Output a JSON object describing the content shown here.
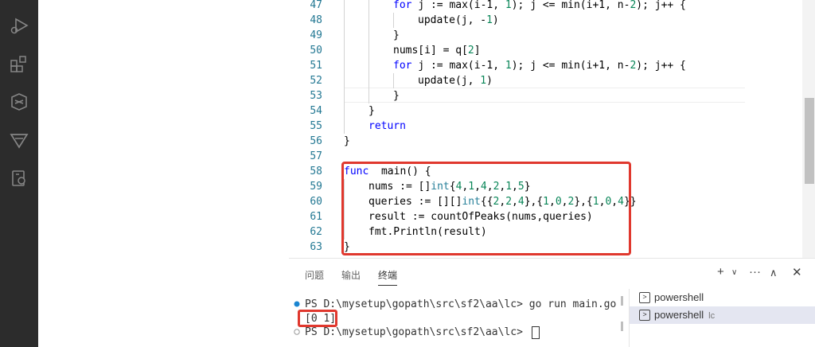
{
  "editor": {
    "lines": [
      {
        "num": "47",
        "indent": 2,
        "tokens": [
          [
            "kw",
            "for"
          ],
          [
            "",
            "j := max(i-1, "
          ],
          [
            "num",
            "1"
          ],
          [
            "",
            "); j <= min(i+1, n-"
          ],
          [
            "num",
            "2"
          ],
          [
            "",
            "); j++ {"
          ]
        ]
      },
      {
        "num": "48",
        "indent": 3,
        "tokens": [
          [
            "",
            "update(j, -"
          ],
          [
            "num",
            "1"
          ],
          [
            "",
            ")"
          ]
        ]
      },
      {
        "num": "49",
        "indent": 2,
        "tokens": [
          [
            "",
            "}"
          ]
        ]
      },
      {
        "num": "50",
        "indent": 2,
        "tokens": [
          [
            "",
            "nums[i] = q["
          ],
          [
            "num",
            "2"
          ],
          [
            "",
            "]"
          ]
        ]
      },
      {
        "num": "51",
        "indent": 2,
        "tokens": [
          [
            "kw",
            "for"
          ],
          [
            "",
            "j := max(i-1, "
          ],
          [
            "num",
            "1"
          ],
          [
            "",
            "); j <= min(i+1, n-"
          ],
          [
            "num",
            "2"
          ],
          [
            "",
            "); j++ {"
          ]
        ]
      },
      {
        "num": "52",
        "indent": 3,
        "tokens": [
          [
            "",
            "update(j, "
          ],
          [
            "num",
            "1"
          ],
          [
            "",
            ")"
          ]
        ]
      },
      {
        "num": "53",
        "indent": 2,
        "tokens": [
          [
            "",
            "}"
          ]
        ]
      },
      {
        "num": "54",
        "indent": 1,
        "tokens": [
          [
            "",
            "}"
          ]
        ]
      },
      {
        "num": "55",
        "indent": 1,
        "tokens": [
          [
            "kw",
            "return"
          ]
        ]
      },
      {
        "num": "56",
        "indent": 0,
        "tokens": [
          [
            "",
            "}"
          ]
        ]
      },
      {
        "num": "57",
        "indent": 0,
        "tokens": []
      },
      {
        "num": "58",
        "indent": 0,
        "tokens": [
          [
            "kw",
            "func"
          ],
          [
            "",
            " main() {"
          ]
        ]
      },
      {
        "num": "59",
        "indent": 1,
        "tokens": [
          [
            "",
            "nums := []"
          ],
          [
            "ty",
            "int"
          ],
          [
            "",
            "{"
          ],
          [
            "num",
            "4"
          ],
          [
            "",
            ","
          ],
          [
            "num",
            "1"
          ],
          [
            "",
            ","
          ],
          [
            "num",
            "4"
          ],
          [
            "",
            ","
          ],
          [
            "num",
            "2"
          ],
          [
            "",
            ","
          ],
          [
            "num",
            "1"
          ],
          [
            "",
            ","
          ],
          [
            "num",
            "5"
          ],
          [
            "",
            "}"
          ]
        ]
      },
      {
        "num": "60",
        "indent": 1,
        "tokens": [
          [
            "",
            "queries := [][]"
          ],
          [
            "ty",
            "int"
          ],
          [
            "",
            "{{"
          ],
          [
            "num",
            "2"
          ],
          [
            "",
            ","
          ],
          [
            "num",
            "2"
          ],
          [
            "",
            ","
          ],
          [
            "num",
            "4"
          ],
          [
            "",
            "},{"
          ],
          [
            "num",
            "1"
          ],
          [
            "",
            ","
          ],
          [
            "num",
            "0"
          ],
          [
            "",
            ","
          ],
          [
            "num",
            "2"
          ],
          [
            "",
            "},{"
          ],
          [
            "num",
            "1"
          ],
          [
            "",
            ","
          ],
          [
            "num",
            "0"
          ],
          [
            "",
            ","
          ],
          [
            "num",
            "4"
          ],
          [
            "",
            "}}"
          ]
        ]
      },
      {
        "num": "61",
        "indent": 1,
        "tokens": [
          [
            "",
            "result := countOfPeaks(nums,queries)"
          ]
        ]
      },
      {
        "num": "62",
        "indent": 1,
        "tokens": [
          [
            "",
            "fmt.Println(result)"
          ]
        ]
      },
      {
        "num": "63",
        "indent": 0,
        "tokens": [
          [
            "",
            "}"
          ]
        ]
      }
    ]
  },
  "panel": {
    "tabs": [
      "问题",
      "输出",
      "终端"
    ],
    "active_tab": "终端"
  },
  "terminal": {
    "lines": [
      "PS D:\\mysetup\\gopath\\src\\sf2\\aa\\lc> go run main.go",
      "[0 1]",
      "PS D:\\mysetup\\gopath\\src\\sf2\\aa\\lc> "
    ],
    "sessions": [
      {
        "label": "powershell",
        "sub": ""
      },
      {
        "label": "powershell",
        "sub": "lc"
      }
    ]
  },
  "colors": {
    "highlight": "#e0382e",
    "activity_bar": "#2c2c2c"
  }
}
